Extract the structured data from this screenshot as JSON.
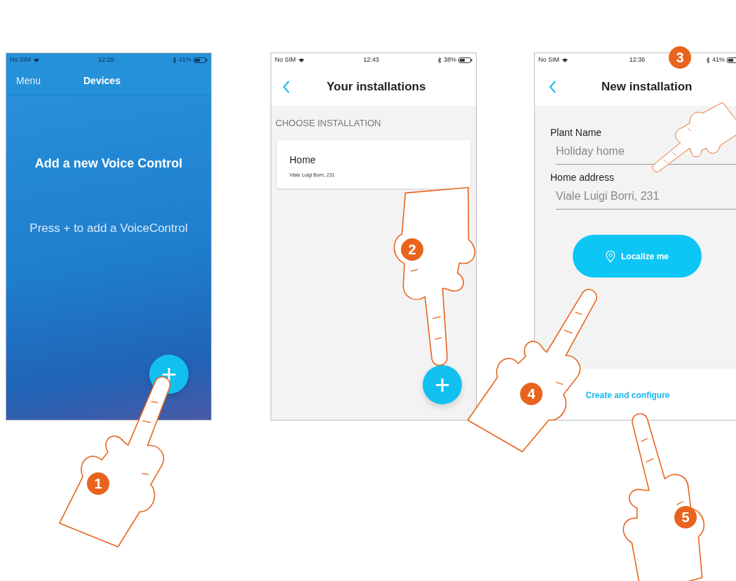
{
  "screens": [
    {
      "kind": "devices",
      "status": {
        "carrier": "No SIM",
        "time": "12:29",
        "battery": "41%"
      },
      "menu": "Menu",
      "title": "Devices",
      "heading": "Add a new Voice Control",
      "hint": "Press + to add a VoiceControl",
      "fab": "+"
    },
    {
      "kind": "installations",
      "status": {
        "carrier": "No SIM",
        "time": "12:43",
        "battery": "38%"
      },
      "title": "Your installations",
      "section": "CHOOSE INSTALLATION",
      "installations": [
        {
          "name": "Home",
          "address": "Viale Luigi Borri, 231"
        }
      ],
      "fab": "+"
    },
    {
      "kind": "new_installation",
      "status": {
        "carrier": "No SIM",
        "time": "12:36",
        "battery": "41%"
      },
      "title": "New installation",
      "fields": [
        {
          "label": "Plant Name",
          "placeholder": "Holiday home"
        },
        {
          "label": "Home address",
          "placeholder": "Viale Luigi Borri, 231"
        }
      ],
      "button": "Localize me",
      "link": "Create and configure"
    }
  ],
  "steps": [
    "1",
    "2",
    "3",
    "4",
    "5"
  ]
}
